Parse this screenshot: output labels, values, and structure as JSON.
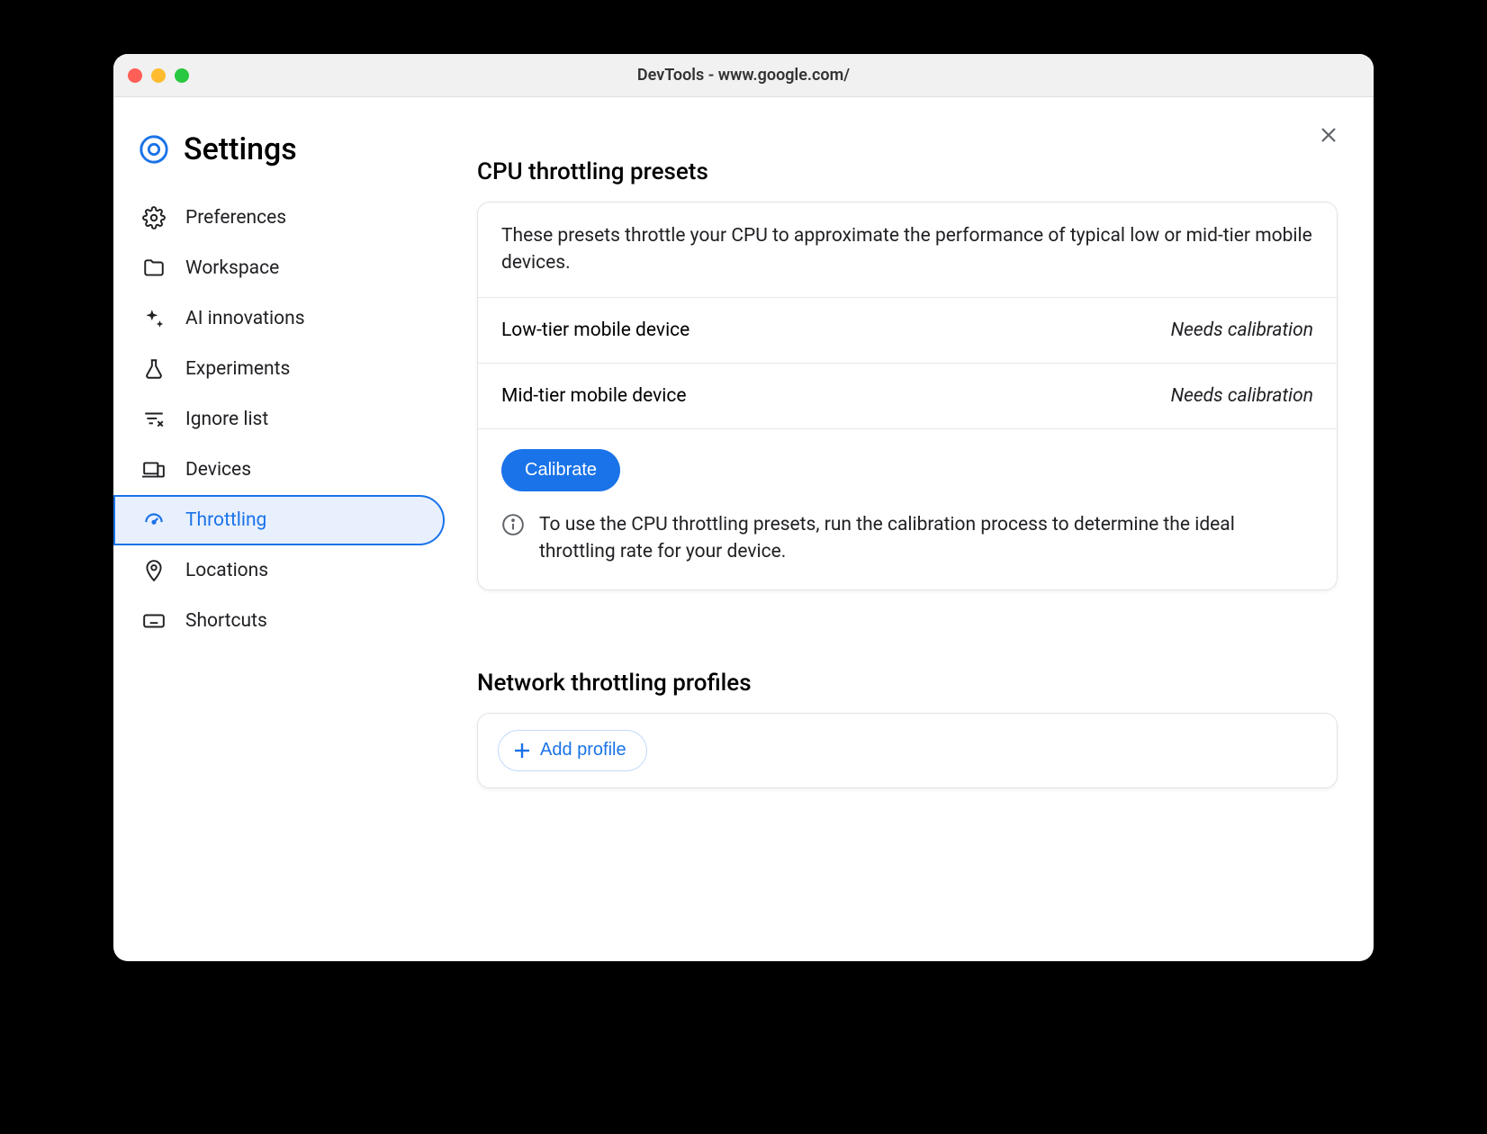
{
  "window": {
    "title": "DevTools - www.google.com/"
  },
  "header": {
    "title": "Settings"
  },
  "sidebar": {
    "items": [
      {
        "label": "Preferences"
      },
      {
        "label": "Workspace"
      },
      {
        "label": "AI innovations"
      },
      {
        "label": "Experiments"
      },
      {
        "label": "Ignore list"
      },
      {
        "label": "Devices"
      },
      {
        "label": "Throttling"
      },
      {
        "label": "Locations"
      },
      {
        "label": "Shortcuts"
      }
    ]
  },
  "cpu": {
    "section_title": "CPU throttling presets",
    "description": "These presets throttle your CPU to approximate the performance of typical low or mid-tier mobile devices.",
    "presets": [
      {
        "name": "Low-tier mobile device",
        "status": "Needs calibration"
      },
      {
        "name": "Mid-tier mobile device",
        "status": "Needs calibration"
      }
    ],
    "calibrate_label": "Calibrate",
    "info_text": "To use the CPU throttling presets, run the calibration process to determine the ideal throttling rate for your device."
  },
  "network": {
    "section_title": "Network throttling profiles",
    "add_label": "Add profile"
  }
}
